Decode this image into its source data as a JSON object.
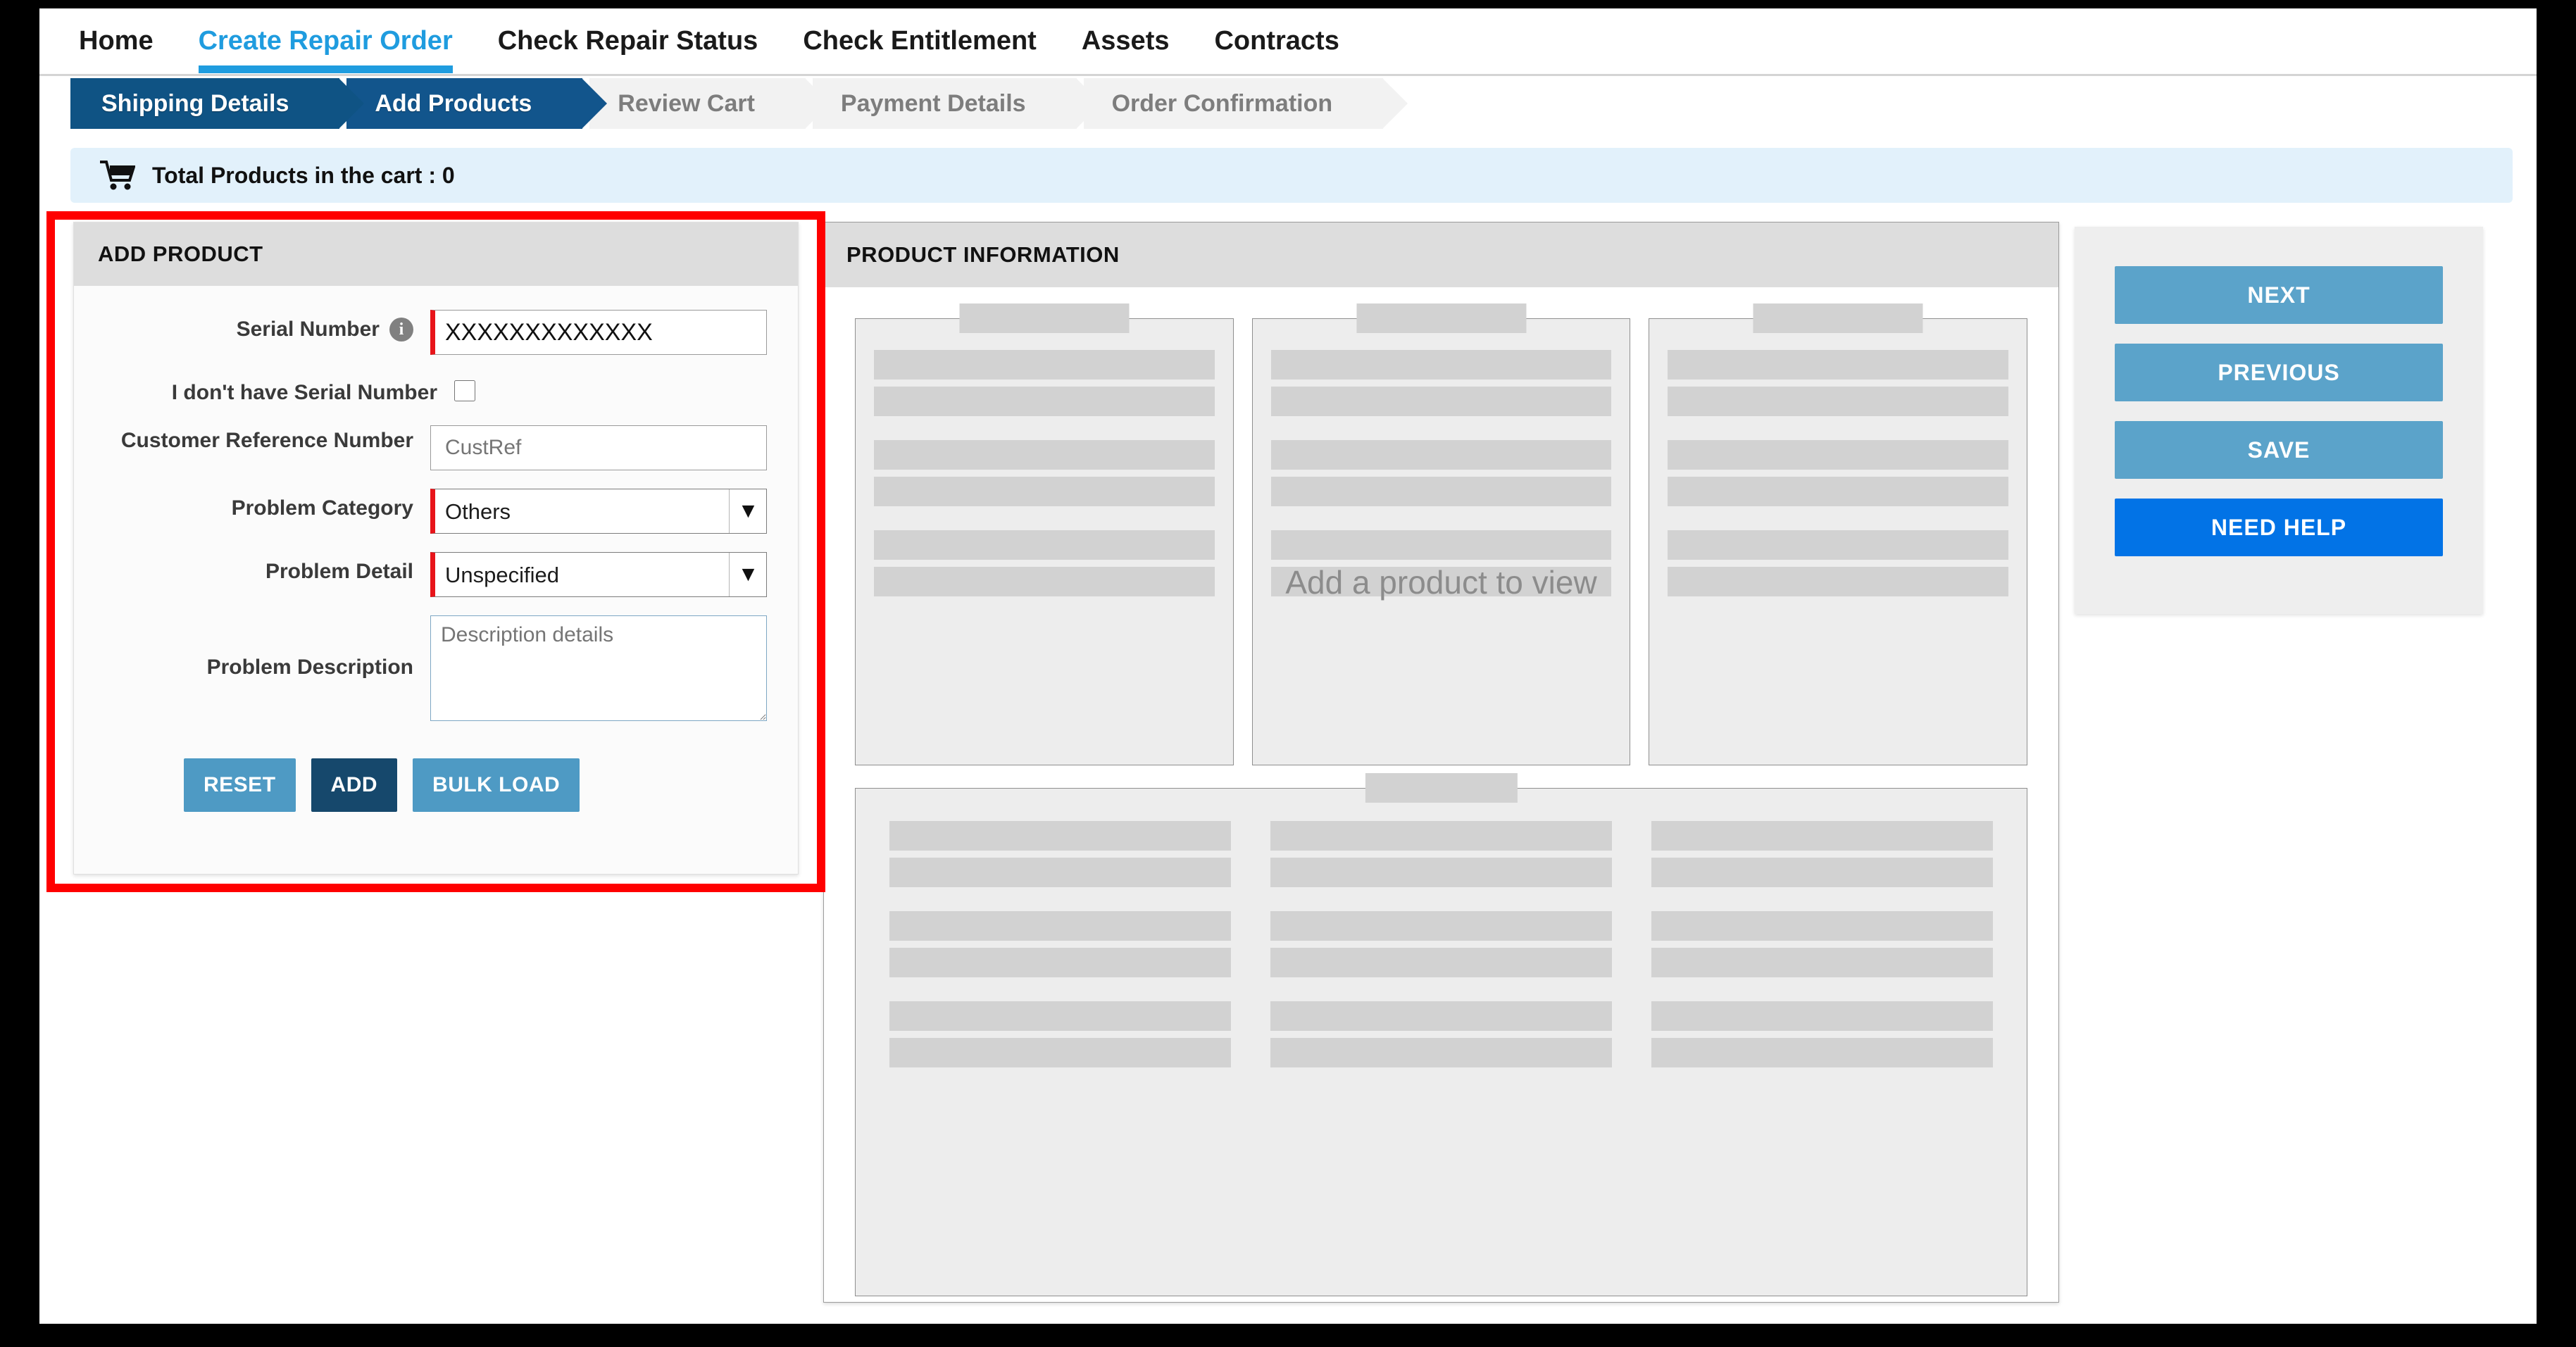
{
  "topnav": {
    "items": [
      {
        "label": "Home",
        "active": false
      },
      {
        "label": "Create Repair Order",
        "active": true
      },
      {
        "label": "Check Repair Status",
        "active": false
      },
      {
        "label": "Check Entitlement",
        "active": false
      },
      {
        "label": "Assets",
        "active": false
      },
      {
        "label": "Contracts",
        "active": false
      }
    ],
    "active_color": "#1f9cdf"
  },
  "stepper": {
    "steps": [
      {
        "label": "Shipping Details",
        "state": "done"
      },
      {
        "label": "Add Products",
        "state": "current"
      },
      {
        "label": "Review Cart",
        "state": "todo"
      },
      {
        "label": "Payment Details",
        "state": "todo"
      },
      {
        "label": "Order Confirmation",
        "state": "todo"
      }
    ],
    "active_color": "#0f5384"
  },
  "cart": {
    "icon": "shopping-cart-icon",
    "label": "Total Products in the cart : 0",
    "count": 0,
    "bg_color": "#e2f1fb"
  },
  "add_product": {
    "title": "ADD PRODUCT",
    "fields": {
      "serial_number": {
        "label": "Serial Number",
        "info_icon": "info-circle-icon",
        "value": "XXXXXXXXXXXXX",
        "placeholder": "Serial Number",
        "required_color": "#e8141a"
      },
      "no_serial": {
        "label": "I don't have Serial Number",
        "checked": false
      },
      "customer_reference": {
        "label": "Customer Reference Number",
        "value": "",
        "placeholder": "CustRef"
      },
      "problem_category": {
        "label": "Problem Category",
        "value": "Others",
        "options": [
          "Others"
        ],
        "icon": "chevron-down-icon"
      },
      "problem_detail": {
        "label": "Problem Detail",
        "value": "Unspecified",
        "options": [
          "Unspecified"
        ],
        "icon": "chevron-down-icon"
      },
      "problem_description": {
        "label": "Problem Description",
        "value": "",
        "placeholder": "Description details"
      }
    },
    "buttons": {
      "reset": "RESET",
      "add": "ADD",
      "bulk_load": "BULK LOAD"
    }
  },
  "annotation": {
    "highlight_color": "#ff0000"
  },
  "product_information": {
    "title": "PRODUCT INFORMATION",
    "empty_message": "Add a product to view",
    "skeleton": {
      "top_cards": 3,
      "top_card_bars": 6,
      "wide_card_columns": 3,
      "wide_card_bars_per_column": 6,
      "bar_color": "#d2d2d2",
      "card_bg": "#ededed"
    }
  },
  "actions": {
    "buttons": [
      {
        "label": "NEXT",
        "style": "normal"
      },
      {
        "label": "PREVIOUS",
        "style": "normal"
      },
      {
        "label": "SAVE",
        "style": "normal"
      },
      {
        "label": "NEED HELP",
        "style": "help"
      }
    ],
    "normal_color": "#5ba3ca",
    "help_color": "#0273e6"
  }
}
